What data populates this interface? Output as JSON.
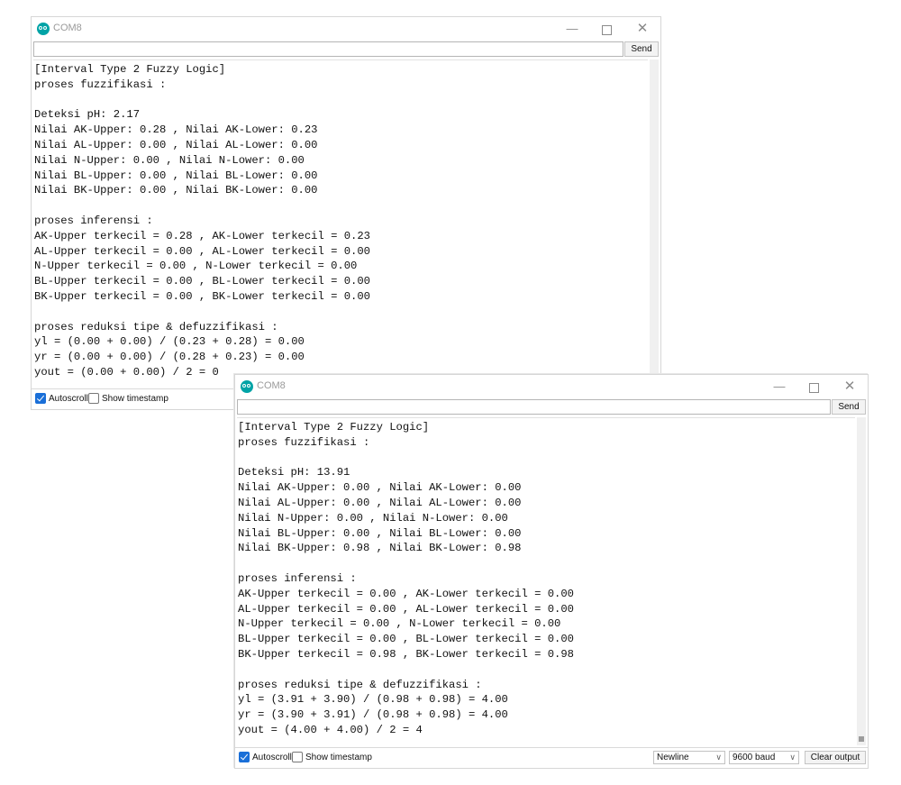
{
  "windows": [
    {
      "title": "COM8",
      "controls": {
        "minimize": "—",
        "close": "✕"
      },
      "input": {
        "value": "",
        "placeholder": ""
      },
      "send_label": "Send",
      "output_lines": [
        "[Interval Type 2 Fuzzy Logic]",
        "proses fuzzifikasi :",
        "",
        "Deteksi pH: 2.17",
        "Nilai AK-Upper: 0.28 , Nilai AK-Lower: 0.23",
        "Nilai AL-Upper: 0.00 , Nilai AL-Lower: 0.00",
        "Nilai N-Upper: 0.00 , Nilai N-Lower: 0.00",
        "Nilai BL-Upper: 0.00 , Nilai BL-Lower: 0.00",
        "Nilai BK-Upper: 0.00 , Nilai BK-Lower: 0.00",
        "",
        "proses inferensi :",
        "AK-Upper terkecil = 0.28 , AK-Lower terkecil = 0.23",
        "AL-Upper terkecil = 0.00 , AL-Lower terkecil = 0.00",
        "N-Upper terkecil = 0.00 , N-Lower terkecil = 0.00",
        "BL-Upper terkecil = 0.00 , BL-Lower terkecil = 0.00",
        "BK-Upper terkecil = 0.00 , BK-Lower terkecil = 0.00",
        "",
        "proses reduksi tipe & defuzzifikasi :",
        "yl = (0.00 + 0.00) / (0.23 + 0.28) = 0.00",
        "yr = (0.00 + 0.00) / (0.28 + 0.23) = 0.00",
        "yout = (0.00 + 0.00) / 2 = 0"
      ],
      "autoscroll_label": "Autoscroll",
      "autoscroll_checked": true,
      "timestamp_label": "Show timestamp",
      "timestamp_checked": false
    },
    {
      "title": "COM8",
      "controls": {
        "minimize": "—",
        "close": "✕"
      },
      "input": {
        "value": "",
        "placeholder": ""
      },
      "send_label": "Send",
      "output_lines": [
        "[Interval Type 2 Fuzzy Logic]",
        "proses fuzzifikasi :",
        "",
        "Deteksi pH: 13.91",
        "Nilai AK-Upper: 0.00 , Nilai AK-Lower: 0.00",
        "Nilai AL-Upper: 0.00 , Nilai AL-Lower: 0.00",
        "Nilai N-Upper: 0.00 , Nilai N-Lower: 0.00",
        "Nilai BL-Upper: 0.00 , Nilai BL-Lower: 0.00",
        "Nilai BK-Upper: 0.98 , Nilai BK-Lower: 0.98",
        "",
        "proses inferensi :",
        "AK-Upper terkecil = 0.00 , AK-Lower terkecil = 0.00",
        "AL-Upper terkecil = 0.00 , AL-Lower terkecil = 0.00",
        "N-Upper terkecil = 0.00 , N-Lower terkecil = 0.00",
        "BL-Upper terkecil = 0.00 , BL-Lower terkecil = 0.00",
        "BK-Upper terkecil = 0.98 , BK-Lower terkecil = 0.98",
        "",
        "proses reduksi tipe & defuzzifikasi :",
        "yl = (3.91 + 3.90) / (0.98 + 0.98) = 4.00",
        "yr = (3.90 + 3.91) / (0.98 + 0.98) = 4.00",
        "yout = (4.00 + 4.00) / 2 = 4"
      ],
      "autoscroll_label": "Autoscroll",
      "autoscroll_checked": true,
      "timestamp_label": "Show timestamp",
      "timestamp_checked": false,
      "line_ending": "Newline",
      "baud_rate": "9600 baud",
      "clear_label": "Clear output"
    }
  ],
  "colors": {
    "accent": "#1a6fd8",
    "logo": "#00a3a6"
  }
}
